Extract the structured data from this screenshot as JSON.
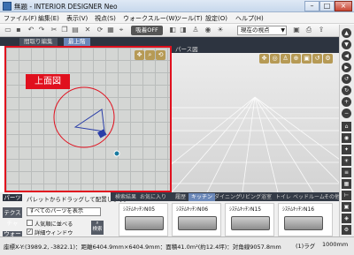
{
  "window": {
    "title": "無題 - INTERIOR DESIGNER Neo",
    "min_label": "–",
    "max_label": "□",
    "close_label": "×"
  },
  "menu": [
    "ファイル(F)",
    "編集(E)",
    "表示(V)",
    "視点(S)",
    "ウォークスルー(W)",
    "ツール(T)",
    "設定(O)",
    "ヘルプ(H)"
  ],
  "toolbar": {
    "toggle_label": "吸着OFF",
    "viewpoint_select": "現在の視点",
    "icons": [
      "folder-icon",
      "save-icon",
      "undo-icon",
      "redo-icon",
      "cut-icon",
      "copy-icon",
      "paste-icon",
      "delete-icon",
      "rotate-icon",
      "grid-icon",
      "snap-icon"
    ]
  },
  "tabs": {
    "floorplan": "間取り編集",
    "floor": "最上階"
  },
  "planview": {
    "label": "上面図",
    "toolbar_icons": [
      "move-view-icon",
      "zoom-icon",
      "rotate-view-icon"
    ]
  },
  "perspview": {
    "title": "パース図",
    "toolbar_icons": [
      "pan-icon",
      "orbit-icon",
      "walk-icon",
      "zoom-in-icon",
      "fit-icon",
      "reset-icon",
      "settings-icon"
    ]
  },
  "right_toolbar": [
    "arrow-up-icon",
    "arrow-down-icon",
    "arrow-left-icon",
    "arrow-right-icon",
    "rotate-left-icon",
    "rotate-right-icon",
    "zoom-in-icon",
    "zoom-out-icon",
    "home-icon",
    "camera-icon",
    "light-icon",
    "sun-icon",
    "layer-icon",
    "grid-icon",
    "measure-icon",
    "capture-icon",
    "render-icon",
    "settings-icon"
  ],
  "parts_panel": {
    "header": "パーツ",
    "side_tabs": [
      "テクスチャ",
      "ウォーク"
    ],
    "hint": "パレットからドラッグして配置します。",
    "category_select": "すべてのパーツを表示",
    "check_option1": "人気順に並べる",
    "check_option2": "詳細ウィンドウ",
    "search_label": "検索",
    "category_tabs": [
      "検索結果",
      "お気に入り",
      "履歴",
      "キッチン",
      "ダイニング",
      "リビング",
      "浴室",
      "トイレ",
      "ベッドルーム",
      "その他"
    ],
    "active_tab_index": 3,
    "items": [
      {
        "label": "ｼｽﾃﾑｷｯﾁﾝN05"
      },
      {
        "label": "ｼｽﾃﾑｷｯﾁﾝN06"
      },
      {
        "label": "ｼｽﾃﾑｷｯﾁﾝN15"
      },
      {
        "label": "ｼｽﾃﾑｷｯﾁﾝN16"
      }
    ]
  },
  "status": {
    "text": "座標X-Y:(3989.2, -3822.1)：距離6404.9mm×6404.9mm：面積41.0m²(約12.4坪)：対角線9057.8mm",
    "snap": "(1)ラグ",
    "unit": "1000mm"
  },
  "colors": {
    "accent_red": "#e0101e",
    "dark_ui": "#2d3440",
    "active_tab": "#6a87b8"
  }
}
